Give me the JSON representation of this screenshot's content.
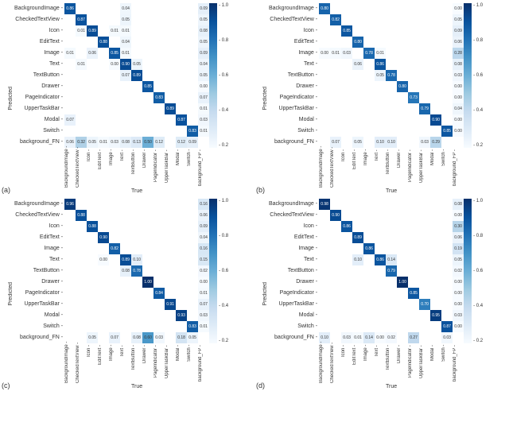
{
  "axis": {
    "x": "True",
    "y": "Predicted",
    "cbar_ticks": [
      "1.0",
      "0.8",
      "0.6",
      "0.4",
      "0.2"
    ]
  },
  "labels": {
    "a": "(a)",
    "b": "(b)",
    "c": "(c)",
    "d": "(d)"
  },
  "chart_data": [
    {
      "id": "a",
      "type": "heatmap",
      "title": "",
      "xlabel": "True",
      "ylabel": "Predicted",
      "range": [
        0,
        1
      ],
      "y": [
        "BackgroundImage",
        "CheckedTextView",
        "Icon",
        "EditText",
        "Image",
        "Text",
        "TextButton",
        "Drawer",
        "PageIndicator",
        "UpperTaskBar",
        "Modal",
        "Switch",
        "background_FN"
      ],
      "x": [
        "BackgroundImage",
        "CheckedTextView",
        "Icon",
        "EditText",
        "Image",
        "Text",
        "TextButton",
        "Drawer",
        "PageIndicator",
        "UpperTaskBar",
        "Modal",
        "Switch",
        "background_FP"
      ],
      "z": [
        [
          0.86,
          null,
          null,
          null,
          null,
          0.04,
          null,
          null,
          null,
          null,
          null,
          null,
          0.09
        ],
        [
          null,
          0.87,
          null,
          null,
          null,
          0.05,
          null,
          null,
          null,
          null,
          null,
          null,
          0.05
        ],
        [
          null,
          0.01,
          0.89,
          null,
          0.01,
          0.01,
          null,
          null,
          null,
          null,
          null,
          null,
          0.08
        ],
        [
          null,
          null,
          null,
          0.88,
          null,
          0.04,
          null,
          null,
          null,
          null,
          null,
          null,
          0.05
        ],
        [
          0.01,
          null,
          0.06,
          null,
          0.85,
          0.01,
          null,
          null,
          null,
          null,
          null,
          null,
          0.09
        ],
        [
          null,
          0.01,
          null,
          null,
          0.0,
          0.9,
          0.05,
          null,
          null,
          null,
          null,
          null,
          0.04
        ],
        [
          null,
          null,
          null,
          null,
          null,
          0.07,
          0.89,
          null,
          null,
          null,
          null,
          null,
          0.05
        ],
        [
          null,
          null,
          null,
          null,
          null,
          null,
          null,
          0.85,
          null,
          null,
          null,
          null,
          0.0
        ],
        [
          null,
          null,
          null,
          null,
          null,
          null,
          null,
          null,
          0.83,
          null,
          null,
          null,
          0.07
        ],
        [
          null,
          null,
          null,
          null,
          null,
          null,
          null,
          null,
          null,
          0.89,
          null,
          null,
          0.01
        ],
        [
          0.07,
          null,
          null,
          null,
          null,
          null,
          null,
          null,
          null,
          null,
          0.87,
          null,
          0.03
        ],
        [
          null,
          null,
          null,
          null,
          null,
          null,
          null,
          null,
          null,
          null,
          null,
          0.83,
          0.01
        ],
        [
          0.06,
          0.32,
          0.05,
          0.01,
          0.03,
          0.08,
          0.13,
          0.5,
          0.12,
          null,
          0.12,
          0.09,
          null
        ]
      ]
    },
    {
      "id": "b",
      "type": "heatmap",
      "title": "",
      "xlabel": "True",
      "ylabel": "Predicted",
      "range": [
        0,
        1
      ],
      "y": [
        "BackgroundImage",
        "CheckedTextView",
        "Icon",
        "EditText",
        "Image",
        "Text",
        "TextButton",
        "Drawer",
        "PageIndicator",
        "UpperTaskBar",
        "Modal",
        "Switch",
        "background_FN"
      ],
      "x": [
        "BackgroundImage",
        "CheckedTextView",
        "Icon",
        "EditText",
        "Image",
        "Text",
        "TextButton",
        "Drawer",
        "PageIndicator",
        "UpperTaskBar",
        "Modal",
        "Switch",
        "background_FP"
      ],
      "z": [
        [
          0.8,
          null,
          null,
          null,
          null,
          null,
          null,
          null,
          null,
          null,
          null,
          null,
          0.0
        ],
        [
          null,
          0.82,
          null,
          null,
          null,
          null,
          null,
          null,
          null,
          null,
          null,
          null,
          0.05
        ],
        [
          null,
          null,
          0.85,
          null,
          null,
          null,
          null,
          null,
          null,
          null,
          null,
          null,
          0.09
        ],
        [
          null,
          null,
          null,
          0.8,
          null,
          null,
          null,
          null,
          null,
          null,
          null,
          null,
          0.06
        ],
        [
          0.0,
          0.01,
          0.03,
          null,
          0.78,
          0.01,
          null,
          null,
          null,
          null,
          null,
          null,
          0.28
        ],
        [
          null,
          null,
          null,
          0.06,
          null,
          0.86,
          null,
          null,
          null,
          null,
          null,
          null,
          0.08
        ],
        [
          null,
          null,
          null,
          null,
          null,
          0.05,
          0.78,
          null,
          null,
          null,
          null,
          null,
          0.03
        ],
        [
          null,
          null,
          null,
          null,
          null,
          null,
          null,
          0.8,
          null,
          null,
          null,
          null,
          0.0
        ],
        [
          null,
          null,
          null,
          null,
          null,
          null,
          null,
          null,
          0.73,
          null,
          null,
          null,
          0.0
        ],
        [
          null,
          null,
          null,
          null,
          null,
          null,
          null,
          null,
          null,
          0.79,
          null,
          null,
          0.04
        ],
        [
          null,
          null,
          null,
          null,
          null,
          null,
          null,
          null,
          null,
          null,
          0.9,
          null,
          0.0
        ],
        [
          null,
          null,
          null,
          null,
          null,
          null,
          null,
          null,
          null,
          null,
          null,
          0.85,
          0.0
        ],
        [
          null,
          0.07,
          null,
          0.05,
          null,
          0.1,
          0.1,
          null,
          null,
          0.03,
          0.29,
          null,
          null
        ]
      ]
    },
    {
      "id": "c",
      "type": "heatmap",
      "title": "",
      "xlabel": "True",
      "ylabel": "Predicted",
      "range": [
        0,
        1
      ],
      "y": [
        "BackgroundImage",
        "CheckedTextView",
        "Icon",
        "EditText",
        "Image",
        "Text",
        "TextButton",
        "Drawer",
        "PageIndicator",
        "UpperTaskBar",
        "Modal",
        "Switch",
        "background_FN"
      ],
      "x": [
        "BackgroundImage",
        "CheckedTextView",
        "Icon",
        "EditText",
        "Image",
        "Text",
        "TextButton",
        "Drawer",
        "PageIndicator",
        "UpperTaskBar",
        "Modal",
        "Switch",
        "background_FP"
      ],
      "z": [
        [
          0.96,
          null,
          null,
          null,
          null,
          null,
          null,
          null,
          null,
          null,
          null,
          null,
          0.16
        ],
        [
          null,
          0.88,
          null,
          null,
          null,
          null,
          null,
          null,
          null,
          null,
          null,
          null,
          0.06
        ],
        [
          null,
          null,
          0.88,
          null,
          null,
          null,
          null,
          null,
          null,
          null,
          null,
          null,
          0.09
        ],
        [
          null,
          null,
          null,
          0.9,
          null,
          null,
          null,
          null,
          null,
          null,
          null,
          null,
          0.04
        ],
        [
          null,
          null,
          null,
          null,
          0.82,
          null,
          null,
          null,
          null,
          null,
          null,
          null,
          0.16
        ],
        [
          null,
          null,
          null,
          0.0,
          null,
          0.89,
          0.1,
          null,
          null,
          null,
          null,
          null,
          0.15
        ],
        [
          null,
          null,
          null,
          null,
          null,
          0.08,
          0.78,
          null,
          null,
          null,
          null,
          null,
          0.02
        ],
        [
          null,
          null,
          null,
          null,
          null,
          null,
          null,
          1.0,
          null,
          null,
          null,
          null,
          0.0
        ],
        [
          null,
          null,
          null,
          null,
          null,
          null,
          null,
          null,
          0.84,
          null,
          null,
          null,
          0.01
        ],
        [
          null,
          null,
          null,
          null,
          null,
          null,
          null,
          null,
          null,
          0.91,
          null,
          null,
          0.07
        ],
        [
          null,
          null,
          null,
          null,
          null,
          null,
          null,
          null,
          null,
          null,
          0.93,
          null,
          0.03
        ],
        [
          null,
          null,
          null,
          null,
          null,
          null,
          null,
          null,
          null,
          null,
          null,
          0.83,
          0.01
        ],
        [
          null,
          null,
          0.05,
          null,
          0.07,
          null,
          0.08,
          0.6,
          0.03,
          null,
          0.18,
          0.05,
          null
        ]
      ]
    },
    {
      "id": "d",
      "type": "heatmap",
      "title": "",
      "xlabel": "True",
      "ylabel": "Predicted",
      "range": [
        0,
        1
      ],
      "y": [
        "BackgroundImage",
        "CheckedTextView",
        "Icon",
        "EditText",
        "Image",
        "Text",
        "TextButton",
        "Drawer",
        "PageIndicator",
        "UpperTaskBar",
        "Modal",
        "Switch",
        "background_FN"
      ],
      "x": [
        "BackgroundImage",
        "CheckedTextView",
        "Icon",
        "EditText",
        "Image",
        "Text",
        "TextButton",
        "Drawer",
        "PageIndicator",
        "UpperTaskBar",
        "Modal",
        "Switch",
        "background_FP"
      ],
      "z": [
        [
          0.98,
          null,
          null,
          null,
          null,
          null,
          null,
          null,
          null,
          null,
          null,
          null,
          0.08
        ],
        [
          null,
          0.9,
          null,
          null,
          null,
          null,
          null,
          null,
          null,
          null,
          null,
          null,
          0.0
        ],
        [
          null,
          null,
          0.86,
          null,
          null,
          null,
          null,
          null,
          null,
          null,
          null,
          null,
          0.3
        ],
        [
          null,
          null,
          null,
          0.89,
          null,
          null,
          null,
          null,
          null,
          null,
          null,
          null,
          0.06
        ],
        [
          null,
          null,
          null,
          null,
          0.86,
          null,
          null,
          null,
          null,
          null,
          null,
          null,
          0.19
        ],
        [
          null,
          null,
          null,
          0.1,
          null,
          0.86,
          0.14,
          null,
          null,
          null,
          null,
          null,
          0.05
        ],
        [
          null,
          null,
          null,
          null,
          null,
          null,
          0.79,
          null,
          null,
          null,
          null,
          null,
          0.02
        ],
        [
          null,
          null,
          null,
          null,
          null,
          null,
          null,
          1.0,
          null,
          null,
          null,
          null,
          0.0
        ],
        [
          null,
          null,
          null,
          null,
          null,
          null,
          null,
          null,
          0.85,
          null,
          null,
          null,
          0.0
        ],
        [
          null,
          null,
          null,
          null,
          null,
          null,
          null,
          null,
          null,
          0.7,
          null,
          null,
          0.0
        ],
        [
          null,
          null,
          null,
          null,
          null,
          null,
          null,
          null,
          null,
          null,
          0.95,
          null,
          0.03
        ],
        [
          null,
          null,
          null,
          null,
          null,
          null,
          null,
          null,
          null,
          null,
          null,
          0.87,
          0.0
        ],
        [
          0.1,
          null,
          0.03,
          0.01,
          0.14,
          0.0,
          0.02,
          null,
          0.27,
          null,
          null,
          0.03,
          null
        ]
      ]
    }
  ]
}
